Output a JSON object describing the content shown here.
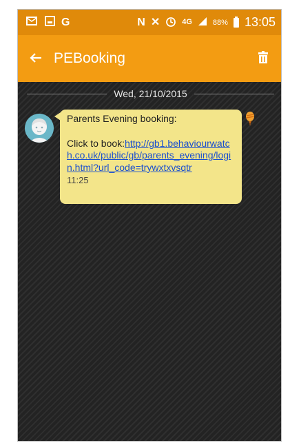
{
  "colors": {
    "status_bar": "#e08a0a",
    "app_bar": "#f39c12",
    "bubble": "#f3e58a",
    "link": "#1a4fcf",
    "background": "#262626"
  },
  "status_bar": {
    "icons": [
      "message-icon",
      "image-icon",
      "google-icon",
      "nfc-icon",
      "mute-icon",
      "alarm-icon",
      "4g-icon",
      "signal-icon",
      "battery-icon"
    ],
    "network": "4G",
    "battery": "88%",
    "time": "13:05"
  },
  "app_bar": {
    "title": "PEBooking",
    "back_icon": "back-arrow-icon",
    "delete_icon": "trash-icon"
  },
  "conversation": {
    "date": "Wed, 21/10/2015",
    "message": {
      "title": "Parents Evening booking:",
      "prompt": "Click to book:",
      "link": "http://gb1.behaviourwatch.co.uk/public/gb/parents_evening/login.html?url_code=trywxtxvsqtr",
      "time": "11:25"
    }
  }
}
